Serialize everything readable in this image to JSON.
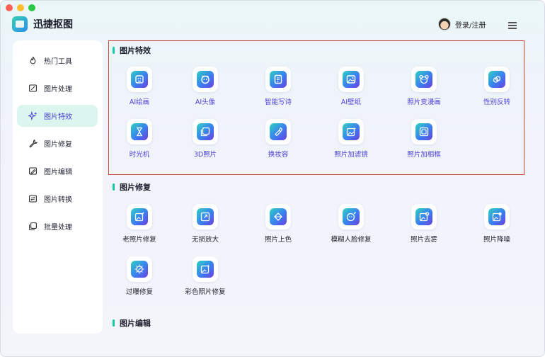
{
  "app": {
    "name": "迅捷抠图"
  },
  "header": {
    "login_label": "登录/注册"
  },
  "sidebar": {
    "items": [
      {
        "label": "热门工具",
        "icon": "flame-icon"
      },
      {
        "label": "图片处理",
        "icon": "image-edit-icon"
      },
      {
        "label": "图片特效",
        "icon": "sparkle-icon",
        "active": true
      },
      {
        "label": "图片修复",
        "icon": "wrench-icon"
      },
      {
        "label": "图片编辑",
        "icon": "pencil-icon"
      },
      {
        "label": "图片转换",
        "icon": "convert-icon"
      },
      {
        "label": "批量处理",
        "icon": "stack-icon"
      }
    ]
  },
  "sections": [
    {
      "title": "图片特效",
      "tools": [
        {
          "label": "AI绘画",
          "icon": "ai-paint-icon"
        },
        {
          "label": "AI头像",
          "icon": "ai-avatar-icon"
        },
        {
          "label": "智能写诗",
          "icon": "poem-icon"
        },
        {
          "label": "AI壁纸",
          "icon": "wallpaper-icon"
        },
        {
          "label": "照片变漫画",
          "icon": "cartoon-bear-icon"
        },
        {
          "label": "性别反转",
          "icon": "gender-swap-icon"
        },
        {
          "label": "时光机",
          "icon": "hourglass-icon"
        },
        {
          "label": "3D照片",
          "icon": "photo-3d-icon"
        },
        {
          "label": "换妆容",
          "icon": "lipstick-icon"
        },
        {
          "label": "照片加滤镜",
          "icon": "filter-icon"
        },
        {
          "label": "照片加相框",
          "icon": "frame-icon"
        }
      ]
    },
    {
      "title": "图片修复",
      "tools": [
        {
          "label": "老照片修复",
          "icon": "old-photo-icon"
        },
        {
          "label": "无损放大",
          "icon": "upscale-icon"
        },
        {
          "label": "照片上色",
          "icon": "colorize-icon"
        },
        {
          "label": "模糊人脸修复",
          "icon": "face-fix-icon"
        },
        {
          "label": "照片去雾",
          "icon": "dehaze-icon"
        },
        {
          "label": "照片降噪",
          "icon": "denoise-icon"
        },
        {
          "label": "过曝修复",
          "icon": "overexposure-icon"
        },
        {
          "label": "彩色照片修复",
          "icon": "color-photo-icon"
        }
      ]
    },
    {
      "title": "图片编辑",
      "tools": []
    }
  ],
  "colors": {
    "accent": "#17c9a6",
    "active_text": "#4a3fd6",
    "highlight_border": "#c94a3d"
  }
}
